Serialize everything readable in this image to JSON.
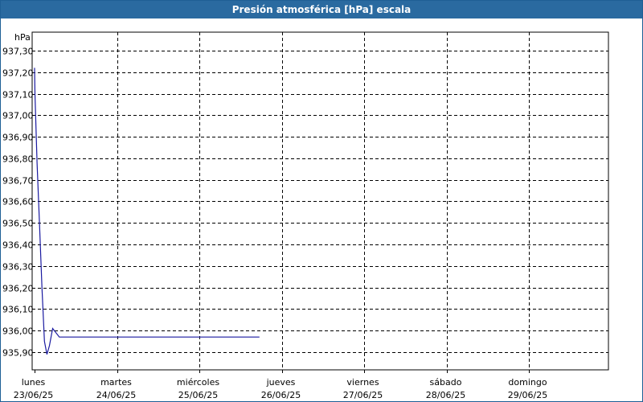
{
  "window": {
    "title": "Presión atmosférica [hPa] escala"
  },
  "chart_data": {
    "type": "line",
    "title": "Presión atmosférica [hPa] escala",
    "ylabel": "hPa",
    "xlabel": "",
    "ylim": [
      935.85,
      937.35
    ],
    "y_ticks": [
      "937,30",
      "937,20",
      "937,10",
      "937,00",
      "936,90",
      "936,80",
      "936,70",
      "936,60",
      "936,50",
      "936,40",
      "936,30",
      "936,20",
      "936,10",
      "936,00",
      "935,90"
    ],
    "y_tick_values": [
      937.3,
      937.2,
      937.1,
      937.0,
      936.9,
      936.8,
      936.7,
      936.6,
      936.5,
      936.4,
      936.3,
      936.2,
      936.1,
      936.0,
      935.9
    ],
    "x_days": [
      {
        "day": "lunes",
        "date": "23/06/25"
      },
      {
        "day": "martes",
        "date": "24/06/25"
      },
      {
        "day": "miércoles",
        "date": "25/06/25"
      },
      {
        "day": "jueves",
        "date": "26/06/25"
      },
      {
        "day": "viernes",
        "date": "27/06/25"
      },
      {
        "day": "sábado",
        "date": "28/06/25"
      },
      {
        "day": "domingo",
        "date": "29/06/25"
      }
    ],
    "grid": true,
    "series_color": "#1a1aa0",
    "series": [
      {
        "x_days": [
          0.0,
          0.005,
          0.03,
          0.06,
          0.09,
          0.12,
          0.15,
          0.18,
          0.22,
          0.3,
          0.5,
          1.0,
          1.5,
          2.0,
          2.5,
          2.73
        ],
        "y": [
          937.22,
          937.1,
          936.78,
          936.5,
          936.2,
          935.95,
          935.89,
          935.93,
          936.01,
          935.97,
          935.97,
          935.97,
          935.97,
          935.97,
          935.97,
          935.97
        ]
      }
    ]
  }
}
